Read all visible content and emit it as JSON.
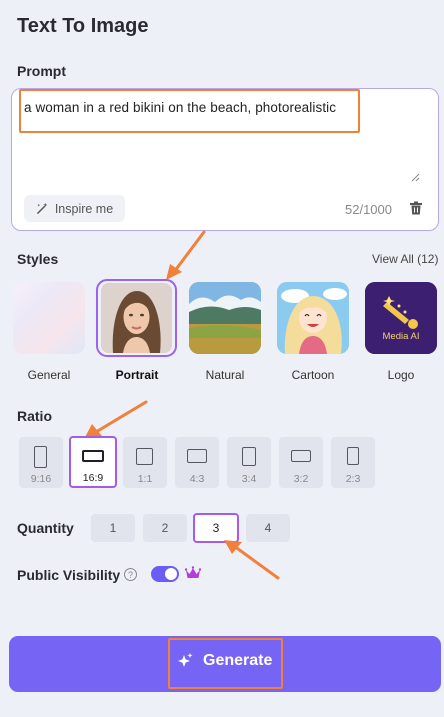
{
  "page": {
    "title": "Text To Image"
  },
  "prompt": {
    "label": "Prompt",
    "text": "a woman in a red bikini on the beach, photorealistic",
    "inspire_label": "Inspire me",
    "counter": "52/1000"
  },
  "styles": {
    "label": "Styles",
    "view_all": "View All (12)",
    "items": [
      {
        "label": "General"
      },
      {
        "label": "Portrait",
        "selected": true
      },
      {
        "label": "Natural"
      },
      {
        "label": "Cartoon"
      },
      {
        "label": "Logo",
        "image_text": "Media AI"
      }
    ]
  },
  "ratio": {
    "label": "Ratio",
    "items": [
      {
        "label": "9:16"
      },
      {
        "label": "16:9",
        "selected": true
      },
      {
        "label": "1:1"
      },
      {
        "label": "4:3"
      },
      {
        "label": "3:4"
      },
      {
        "label": "3:2"
      },
      {
        "label": "2:3"
      }
    ]
  },
  "quantity": {
    "label": "Quantity",
    "items": [
      "1",
      "2",
      "3",
      "4"
    ],
    "selected": "3"
  },
  "visibility": {
    "label": "Public Visibility",
    "help_glyph": "?",
    "enabled": true
  },
  "generate": {
    "label": "Generate"
  },
  "colors": {
    "accent": "#7664f5",
    "selection": "#a45be8",
    "annotation": "#f0803a"
  }
}
